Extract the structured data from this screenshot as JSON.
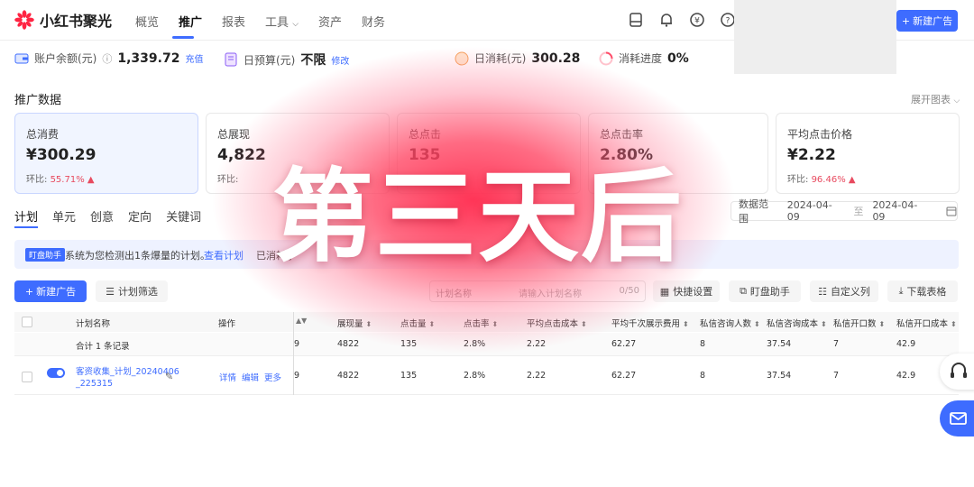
{
  "brand": {
    "logo_text": "小红书聚光",
    "accent": "#3e6cff",
    "brand_red": "#ff2442"
  },
  "nav": {
    "items": [
      {
        "label": "概览"
      },
      {
        "label": "推广"
      },
      {
        "label": "报表"
      },
      {
        "label": "工具"
      },
      {
        "label": "资产"
      },
      {
        "label": "财务"
      }
    ],
    "active": "推广",
    "new_ad_button": "新建广告"
  },
  "account": {
    "balance_label": "账户余额(元)",
    "balance_value": "1,339.72",
    "recharge_link": "充值",
    "budget_label": "日预算(元)",
    "budget_value": "不限",
    "modify_link": "修改",
    "daily_spend_label": "日消耗(元)",
    "daily_spend_value": "300.28",
    "progress_label": "消耗进度",
    "progress_value": "0%"
  },
  "promo": {
    "title": "推广数据",
    "expand_label": "展开图表",
    "cards": [
      {
        "label": "总消费",
        "value": "¥300.29",
        "ratio_label": "环比:",
        "ratio_value": "55.71%"
      },
      {
        "label": "总展现",
        "value": "4,822",
        "ratio_label": "环比:",
        "ratio_value": ""
      },
      {
        "label": "总点击",
        "value": "135",
        "ratio_label": "",
        "ratio_value": ""
      },
      {
        "label": "总点击率",
        "value": "2.80%",
        "ratio_label": "",
        "ratio_value": ""
      },
      {
        "label": "平均点击价格",
        "value": "¥2.22",
        "ratio_label": "环比:",
        "ratio_value": "96.46%"
      }
    ]
  },
  "tabs": {
    "items": [
      {
        "label": "计划"
      },
      {
        "label": "单元"
      },
      {
        "label": "创意"
      },
      {
        "label": "定向"
      },
      {
        "label": "关键词"
      }
    ],
    "active": "计划"
  },
  "date_range": {
    "label": "数据范围",
    "start": "2024-04-09",
    "separator": "至",
    "end": "2024-04-09"
  },
  "notice": {
    "badge": "盯盘助手",
    "text": "系统为您检测出1条爆量的计划。",
    "link": "查看计划",
    "text_tail": "已消耗了"
  },
  "toolbar": {
    "new_ad": "新建广告",
    "filter": "计划筛选",
    "search_prefix": "计划名称",
    "search_placeholder": "请输入计划名称",
    "search_count": "0/50",
    "quick_settings": "快捷设置",
    "monitor": "盯盘助手",
    "custom_columns": "自定义列",
    "download": "下载表格"
  },
  "table": {
    "columns": [
      {
        "label": "计划名称"
      },
      {
        "label": "操作"
      },
      {
        "label": "展现量"
      },
      {
        "label": "点击量"
      },
      {
        "label": "点击率"
      },
      {
        "label": "平均点击成本"
      },
      {
        "label": "平均千次展示费用"
      },
      {
        "label": "私信咨询人数"
      },
      {
        "label": "私信咨询成本"
      },
      {
        "label": "私信开口数"
      },
      {
        "label": "私信开口成本"
      }
    ],
    "summary": {
      "label": "合计 1 条记录",
      "partial_col": "9",
      "impressions": "4822",
      "clicks": "135",
      "ctr": "2.8%",
      "avg_click_cost": "2.22",
      "cpm": "62.27",
      "dm_consult": "8",
      "dm_consult_cost": "37.54",
      "dm_open": "7",
      "dm_open_cost": "42.9"
    },
    "rows": [
      {
        "name_line1": "客资收集_计划_20240406",
        "name_line2": "_225315",
        "actions": [
          "详情",
          "编辑",
          "更多"
        ],
        "partial_col": "9",
        "impressions": "4822",
        "clicks": "135",
        "ctr": "2.8%",
        "avg_click_cost": "2.22",
        "cpm": "62.27",
        "dm_consult": "8",
        "dm_consult_cost": "37.54",
        "dm_open": "7",
        "dm_open_cost": "42.9",
        "enabled": true
      }
    ]
  },
  "overlay": {
    "text": "第三天后"
  },
  "icons": [
    "xhs-logo-icon",
    "chevron-down-icon",
    "document-icon",
    "bell-icon",
    "yen-icon",
    "help-icon",
    "plus-icon",
    "wallet-icon",
    "calendar-icon",
    "filter-icon",
    "grid-icon",
    "export-icon",
    "list-icon",
    "download-icon",
    "edit-icon",
    "headset-icon",
    "mail-icon"
  ]
}
